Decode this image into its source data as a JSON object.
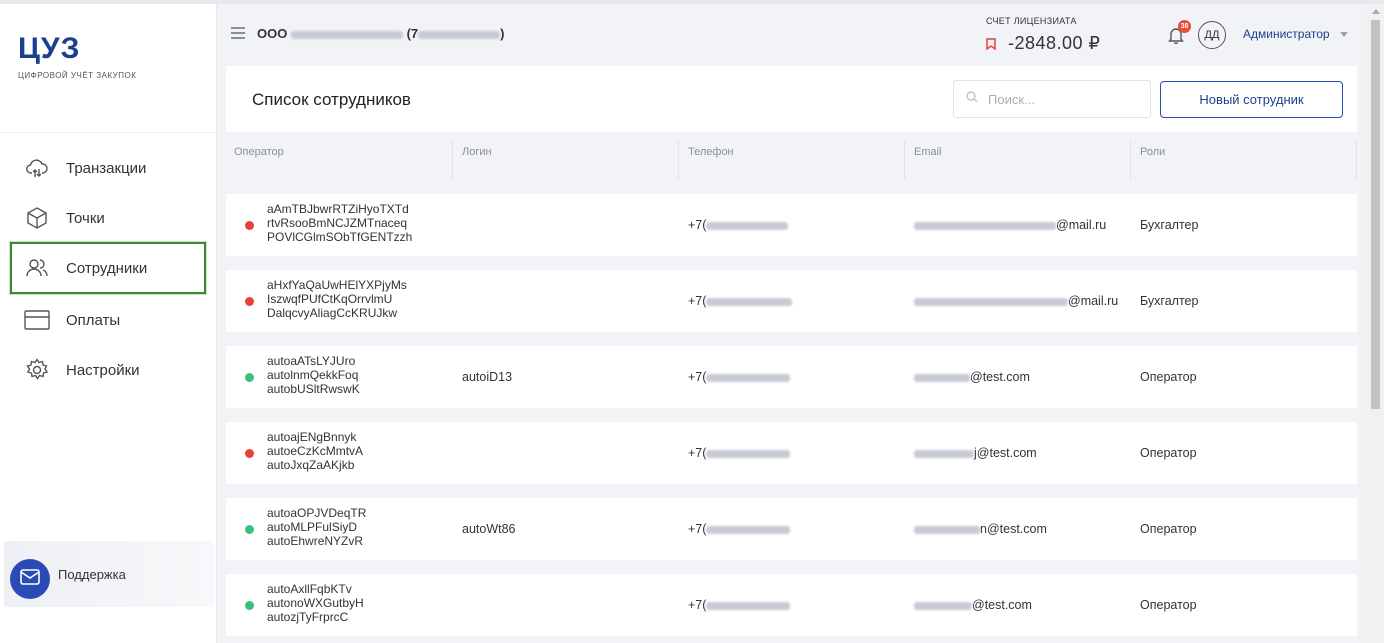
{
  "app": {
    "logo": "ЦУЗ",
    "subtitle": "ЦИФРОВОЙ УЧЁТ ЗАКУПОК"
  },
  "sidebar": {
    "items": [
      {
        "label": "Транзакции",
        "icon": "cloud-transfer-icon"
      },
      {
        "label": "Точки",
        "icon": "cube-icon"
      },
      {
        "label": "Сотрудники",
        "icon": "users-icon",
        "active": true
      },
      {
        "label": "Оплаты",
        "icon": "card-icon"
      },
      {
        "label": "Настройки",
        "icon": "gear-icon"
      }
    ],
    "support_label": "Поддержка"
  },
  "header": {
    "org_prefix": "ООО",
    "org_suffix": "(7",
    "org_close": ")",
    "license_label": "СЧЕТ ЛИЦЕНЗИАТА",
    "license_amount": "-2848.00 ₽",
    "notifications_count": "38",
    "avatar_initials": "ДД",
    "user_role": "Администратор"
  },
  "page": {
    "title": "Список сотрудников",
    "search_placeholder": "Поиск...",
    "new_button": "Новый сотрудник"
  },
  "table": {
    "columns": [
      "Оператор",
      "Логин",
      "Телефон",
      "Email",
      "Роли"
    ],
    "rows": [
      {
        "status": "red",
        "operator": [
          "aAmTBJbwrRTZiHyoTXTd",
          "rtvRsooBmNCJZMTnaceq",
          "POVlCGlmSObTfGENTzzh"
        ],
        "login": "",
        "phone": "+7(",
        "email": "@mail.ru",
        "role": "Бухгалтер"
      },
      {
        "status": "red",
        "operator": [
          "aHxfYaQaUwHElYXPjyMs",
          "IszwqfPUfCtKqOrrvlmU",
          "DalqcvyAliagCcKRUJkw"
        ],
        "login": "",
        "phone": "+7(",
        "email": "@mail.ru",
        "role": "Бухгалтер"
      },
      {
        "status": "green",
        "operator": [
          "autoaATsLYJUro",
          "autolnmQekkFoq",
          "autobUSltRwswK"
        ],
        "login": "autoiD13",
        "phone": "+7(",
        "email": "@test.com",
        "role": "Оператор"
      },
      {
        "status": "red",
        "operator": [
          "autoajENgBnnyk",
          "autoeCzKcMmtvA",
          "autoJxqZaAKjkb"
        ],
        "login": "",
        "phone": "+7(",
        "email": "j@test.com",
        "role": "Оператор"
      },
      {
        "status": "green",
        "operator": [
          "autoaOPJVDeqTR",
          "autoMLPFulSiyD",
          "autoEhwreNYZvR"
        ],
        "login": "autoWt86",
        "phone": "+7(",
        "email": "n@test.com",
        "role": "Оператор"
      },
      {
        "status": "green",
        "operator": [
          "autoAxllFqbKTv",
          "autonoWXGutbyH",
          "autozjTyFrprcC"
        ],
        "login": "",
        "phone": "+7(",
        "email": "@test.com",
        "role": "Оператор"
      }
    ]
  },
  "colors": {
    "brand": "#1b3f8f",
    "accent": "#2a4bb5",
    "active_outline": "#3c8a2e",
    "status_red": "#e8403a",
    "status_green": "#36c27a",
    "badge": "#ee4a3a"
  }
}
